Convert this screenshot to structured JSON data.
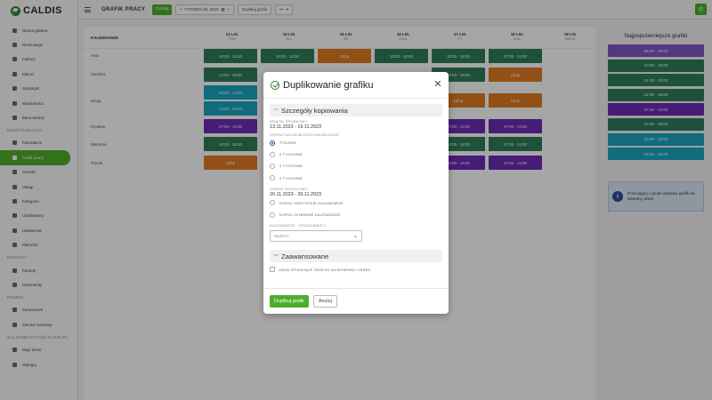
{
  "brand": {
    "name": "CALDIS"
  },
  "sidebar": {
    "items": [
      {
        "label": "Strona główna"
      },
      {
        "label": "Rezerwacje"
      },
      {
        "label": "Faktury"
      },
      {
        "label": "Klienci"
      },
      {
        "label": "Statystyki"
      },
      {
        "label": "Wiadomości"
      },
      {
        "label": "Baza wiedzy"
      }
    ],
    "section_config": "KONFIGURACJA",
    "config_items": [
      {
        "label": "Kalendarze"
      },
      {
        "label": "Grafik pracy"
      },
      {
        "label": "Cenniki"
      },
      {
        "label": "Usługi"
      },
      {
        "label": "Kategorie"
      },
      {
        "label": "Użytkownicy"
      },
      {
        "label": "Ustawienia"
      },
      {
        "label": "Płatności"
      }
    ],
    "section_addons": "DODATKI",
    "addon_items": [
      {
        "label": "Karnety"
      },
      {
        "label": "Dokumenty"
      }
    ],
    "section_help": "POMOC",
    "help_items": [
      {
        "label": "Samouczek"
      },
      {
        "label": "Zamów rozmowę"
      }
    ],
    "section_account": "SALONBEAUTY@CALDIS.PL",
    "account_items": [
      {
        "label": "Moje konto"
      },
      {
        "label": "Wyloguj"
      }
    ]
  },
  "topbar": {
    "title": "GRAFIK PRACY",
    "today_label": "Dzisiaj",
    "week_label": "TYDZIEŃ 46, 2023",
    "duplicate_label": "Duplikuj grafik",
    "more_label": "•••"
  },
  "schedule": {
    "calendars_header": "KALENDARZE",
    "days": [
      {
        "date": "13 LIS.",
        "weekday": "PON."
      },
      {
        "date": "14 LIS.",
        "weekday": "WT."
      },
      {
        "date": "15 LIS.",
        "weekday": "ŚR."
      },
      {
        "date": "16 LIS.",
        "weekday": "CZW."
      },
      {
        "date": "17 LIS.",
        "weekday": "PT."
      },
      {
        "date": "18 LIS.",
        "weekday": "SOB."
      },
      {
        "date": "19 LIS.",
        "weekday": "NIEDZ."
      }
    ],
    "rows": [
      {
        "name": "Ania"
      },
      {
        "name": "Karolina"
      },
      {
        "name": "Kinga"
      },
      {
        "name": "Krystian"
      },
      {
        "name": "Marzena"
      },
      {
        "name": "Tomek"
      }
    ],
    "shifts": [
      {
        "text": "10:00 - 14:00",
        "color": "#2e7d5a"
      },
      {
        "text": "10:00 - 18:00",
        "color": "#2e7d5a"
      },
      {
        "text": "Urlop",
        "color": "#e07b23"
      },
      {
        "text": "10:00 - 18:00",
        "color": "#2e7d5a"
      },
      {
        "text": "10:00 - 18:00",
        "color": "#2e7d5a"
      },
      {
        "text": "07:00 - 14:00",
        "color": "#2e7d5a"
      },
      {
        "text": "14:00 - 19:00",
        "color": "#2e7d5a"
      },
      {
        "text": "10:00 - 18:00",
        "color": "#2e7d5a"
      },
      {
        "text": "Urlop",
        "color": "#e07b23"
      },
      {
        "text": "08:00 - 12:00",
        "color": "#19a7c1"
      },
      {
        "text": "Urlop",
        "color": "#e07b23"
      },
      {
        "text": "Urlop",
        "color": "#e07b23"
      },
      {
        "text": "14:00 - 20:00",
        "color": "#19a7c1"
      },
      {
        "text": "07:00 - 12:00",
        "color": "#6b2bb5"
      },
      {
        "text": "07:00 - 12:00",
        "color": "#6b2bb5"
      },
      {
        "text": "07:00 - 12:00",
        "color": "#6b2bb5"
      },
      {
        "text": "10:00 - 18:00",
        "color": "#2e7d5a"
      },
      {
        "text": "10:00 - 18:00",
        "color": "#2e7d5a"
      },
      {
        "text": "07:00 - 14:00",
        "color": "#2e7d5a"
      },
      {
        "text": "Urlop",
        "color": "#e07b23"
      },
      {
        "text": "10:00 - 18:00",
        "color": "#6b2bb5"
      },
      {
        "text": "07:00 - 14:00",
        "color": "#6b2bb5"
      }
    ]
  },
  "popular": {
    "title": "Najpopularniejsze grafiki",
    "items": [
      {
        "text": "08:00 - 20:00",
        "color": "#7e57c2"
      },
      {
        "text": "10:00 - 18:00",
        "color": "#2e7d5a"
      },
      {
        "text": "14:00 - 18:00",
        "color": "#2e7d5a"
      },
      {
        "text": "14:00 - 18:00",
        "color": "#2e7d5a"
      },
      {
        "text": "07:00 - 12:00",
        "color": "#6b2bb5"
      },
      {
        "text": "07:00 - 18:00",
        "color": "#2e7d5a"
      },
      {
        "text": "10:00 - 18:00",
        "color": "#19a7c1"
      },
      {
        "text": "15:00 - 18:00",
        "color": "#19a7c1"
      }
    ],
    "info_text": "Przeciągnij i upuść wybrany grafik na dowolny dzień."
  },
  "modal": {
    "title": "Duplikowanie grafiku",
    "section_details": "Szczegóły kopiowania",
    "source_label": "GRAFIK ŹRÓDŁOWY",
    "source_value": "13.11.2023 - 19.11.2023",
    "copy_label": "KOPIUJ NA NAJBLIŻSZY/NAJBLIŻSZE",
    "copy_options": [
      {
        "label": "TYDZIEŃ"
      },
      {
        "label": "2 TYGODNIE"
      },
      {
        "label": "3 TYGODNIE"
      },
      {
        "label": "4 TYGODNIE"
      }
    ],
    "target_label": "GRAFIK DOCELOWY",
    "target_value": "20.11.2023 - 26.11.2023",
    "calendar_options": [
      {
        "label": "KOPIUJ WSZYSTKIE KALENDARZE"
      },
      {
        "label": "KOPIUJ WYBRANE KALENDARZE"
      }
    ],
    "employees_label": "KALENDARZE - PRACOWNICY",
    "employees_placeholder": "Wybierz",
    "section_advanced": "Zaawansowane",
    "remove_existing_label": "USUŃ ISTNIEJĄCE GRAFIKI NA WYBRANY OKRES",
    "submit_label": "Duplikuj grafik",
    "cancel_label": "Anuluj"
  }
}
